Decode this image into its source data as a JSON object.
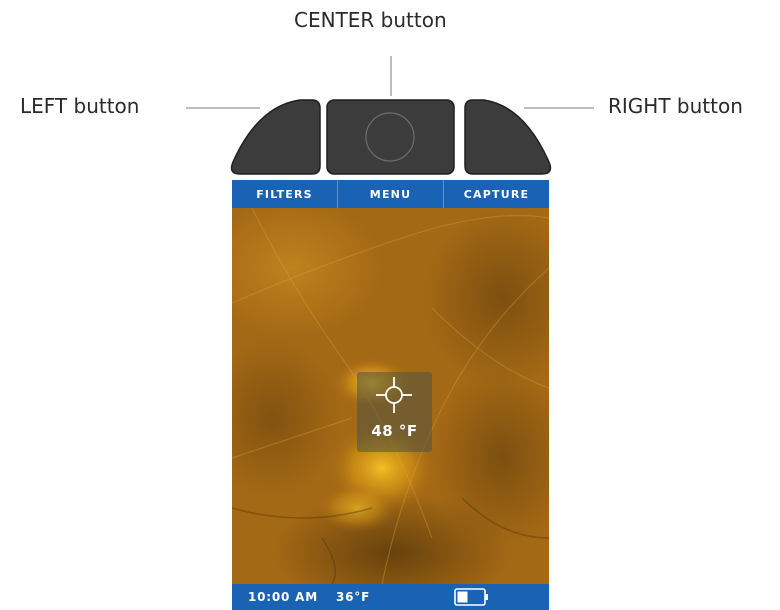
{
  "callouts": {
    "center": "CENTER button",
    "left": "LEFT button",
    "right": "RIGHT button"
  },
  "softkeys": [
    {
      "label": "FILTERS"
    },
    {
      "label": "MENU"
    },
    {
      "label": "CAPTURE"
    }
  ],
  "spot": {
    "temperature": "48 °F",
    "icon": "crosshair-icon"
  },
  "status": {
    "time": "10:00 AM",
    "ambient_temp": "36°F",
    "battery_icon": "battery-icon"
  },
  "colors": {
    "bar_blue": "#1a63b4",
    "button_gray": "#3c3c3c",
    "thermal_amber": "#a66a14"
  }
}
